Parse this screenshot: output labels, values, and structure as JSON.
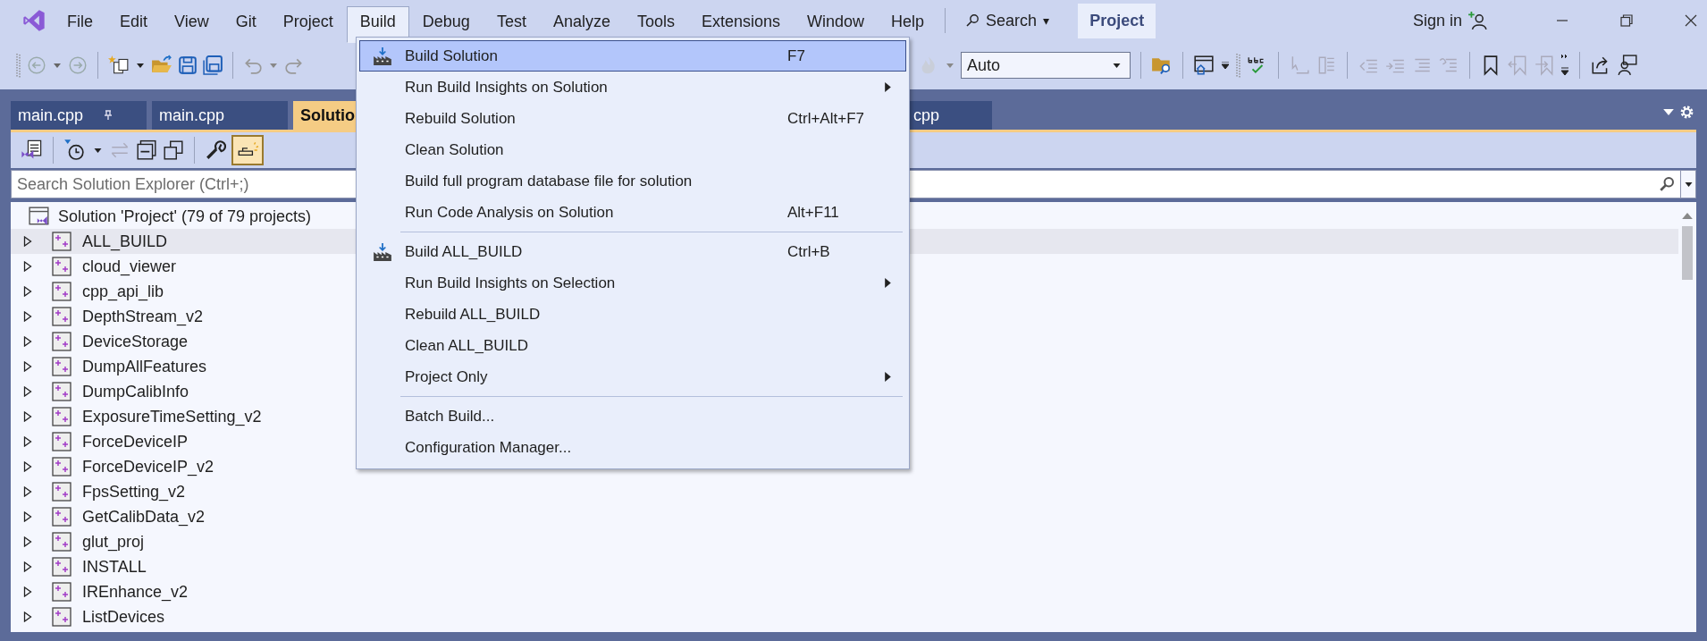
{
  "menu_bar": [
    {
      "label": "File",
      "selected": false
    },
    {
      "label": "Edit",
      "selected": false
    },
    {
      "label": "View",
      "selected": false
    },
    {
      "label": "Git",
      "selected": false
    },
    {
      "label": "Project",
      "selected": false
    },
    {
      "label": "Build",
      "selected": true
    },
    {
      "label": "Debug",
      "selected": false
    },
    {
      "label": "Test",
      "selected": false
    },
    {
      "label": "Analyze",
      "selected": false
    },
    {
      "label": "Tools",
      "selected": false
    },
    {
      "label": "Extensions",
      "selected": false
    },
    {
      "label": "Window",
      "selected": false
    },
    {
      "label": "Help",
      "selected": false
    }
  ],
  "search": {
    "label": "Search",
    "caret": "▾"
  },
  "solution_name": "Project",
  "sign_in": "Sign in",
  "configuration": {
    "value": "Auto"
  },
  "tabs": [
    {
      "label": "main.cpp",
      "pinned": true,
      "selected": false
    },
    {
      "label": "main.cpp",
      "pinned": false,
      "selected": false
    },
    {
      "label": "Solutio",
      "pinned": false,
      "selected": true
    },
    {
      "label": "cpp",
      "pinned": false,
      "selected": false
    }
  ],
  "explorer_toolbar": {
    "preview_on": true
  },
  "explorer_search": {
    "placeholder": "Search Solution Explorer (Ctrl+;)"
  },
  "tree": {
    "root": "Solution 'Project' (79 of 79 projects)",
    "children": [
      {
        "label": "ALL_BUILD",
        "expanded": false,
        "selected": true
      },
      {
        "label": "cloud_viewer",
        "expanded": false,
        "selected": false
      },
      {
        "label": "cpp_api_lib",
        "expanded": false,
        "selected": false
      },
      {
        "label": "DepthStream_v2",
        "expanded": false,
        "selected": false
      },
      {
        "label": "DeviceStorage",
        "expanded": false,
        "selected": false
      },
      {
        "label": "DumpAllFeatures",
        "expanded": false,
        "selected": false
      },
      {
        "label": "DumpCalibInfo",
        "expanded": false,
        "selected": false
      },
      {
        "label": "ExposureTimeSetting_v2",
        "expanded": false,
        "selected": false
      },
      {
        "label": "ForceDeviceIP",
        "expanded": false,
        "selected": false
      },
      {
        "label": "ForceDeviceIP_v2",
        "expanded": false,
        "selected": false
      },
      {
        "label": "FpsSetting_v2",
        "expanded": false,
        "selected": false
      },
      {
        "label": "GetCalibData_v2",
        "expanded": false,
        "selected": false
      },
      {
        "label": "glut_proj",
        "expanded": false,
        "selected": false
      },
      {
        "label": "INSTALL",
        "expanded": false,
        "selected": false
      },
      {
        "label": "IREnhance_v2",
        "expanded": false,
        "selected": false
      },
      {
        "label": "ListDevices",
        "expanded": false,
        "selected": false
      }
    ]
  },
  "build_menu": {
    "groups": [
      [
        {
          "label": "Build Solution",
          "shortcut": "F7",
          "has_icon": true,
          "submenu": false,
          "selected": true
        },
        {
          "label": "Run Build Insights on Solution",
          "has_icon": false,
          "submenu": true,
          "selected": false
        },
        {
          "label": "Rebuild Solution",
          "shortcut": "Ctrl+Alt+F7",
          "has_icon": false,
          "submenu": false,
          "selected": false
        },
        {
          "label": "Clean Solution",
          "has_icon": false,
          "submenu": false,
          "selected": false
        },
        {
          "label": "Build full program database file for solution",
          "has_icon": false,
          "submenu": false,
          "selected": false
        },
        {
          "label": "Run Code Analysis on Solution",
          "shortcut": "Alt+F11",
          "has_icon": false,
          "submenu": false,
          "selected": false
        }
      ],
      [
        {
          "label": "Build ALL_BUILD",
          "shortcut": "Ctrl+B",
          "has_icon": true,
          "submenu": false,
          "selected": false
        },
        {
          "label": "Run Build Insights on Selection",
          "has_icon": false,
          "submenu": true,
          "selected": false
        },
        {
          "label": "Rebuild ALL_BUILD",
          "has_icon": false,
          "submenu": false,
          "selected": false
        },
        {
          "label": "Clean ALL_BUILD",
          "has_icon": false,
          "submenu": false,
          "selected": false
        },
        {
          "label": "Project Only",
          "has_icon": false,
          "submenu": true,
          "selected": false
        }
      ],
      [
        {
          "label": "Batch Build...",
          "has_icon": false,
          "submenu": false,
          "selected": false
        },
        {
          "label": "Configuration Manager...",
          "has_icon": false,
          "submenu": false,
          "selected": false
        }
      ]
    ]
  }
}
